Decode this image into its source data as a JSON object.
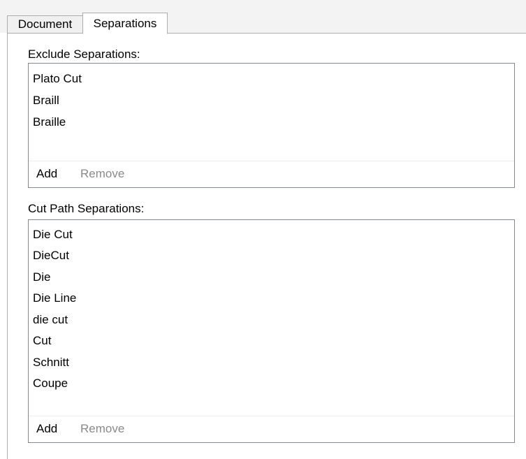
{
  "tabs": {
    "document": "Document",
    "separations": "Separations"
  },
  "exclude": {
    "label": "Exclude Separations:",
    "items": [
      "Plato Cut",
      "Braill",
      "Braille"
    ],
    "add_label": "Add",
    "remove_label": "Remove"
  },
  "cutpath": {
    "label": "Cut Path Separations:",
    "items": [
      "Die Cut",
      "DieCut",
      "Die",
      "Die Line",
      "die cut",
      "Cut",
      "Schnitt",
      "Coupe"
    ],
    "add_label": "Add",
    "remove_label": "Remove"
  },
  "colors": {
    "tab_border": "#adadad",
    "list_border": "#828790",
    "disabled_text": "#8a8a8a"
  }
}
